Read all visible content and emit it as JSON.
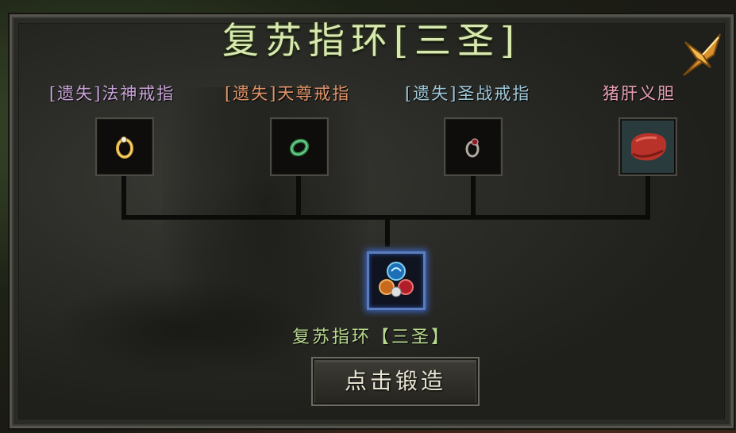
{
  "window": {
    "title": "复苏指环[三圣]"
  },
  "materials": [
    {
      "tag": "[遗失]",
      "name": "法神戒指",
      "tag_color": "#c7a3d8",
      "name_color": "#c7a3d8",
      "icon": "gold-ring-icon"
    },
    {
      "tag": "[遗失]",
      "name": "天尊戒指",
      "tag_color": "#e0956a",
      "name_color": "#e0956a",
      "icon": "jade-ring-icon"
    },
    {
      "tag": "[遗失]",
      "name": "圣战戒指",
      "tag_color": "#9fc8d8",
      "name_color": "#9fc8d8",
      "icon": "gem-ring-icon"
    },
    {
      "tag": "",
      "name": "猪肝义胆",
      "tag_color": "#e8a0b8",
      "name_color": "#e8a0b8",
      "icon": "red-organ-icon"
    }
  ],
  "result": {
    "name": "复苏指环【三圣】",
    "icon": "triple-gem-ring-icon"
  },
  "forge_button": {
    "label": "点击锻造"
  },
  "colors": {
    "title": "#d8e8b0",
    "result_name": "#b9d98f",
    "result_border": "#5a7dbd"
  }
}
